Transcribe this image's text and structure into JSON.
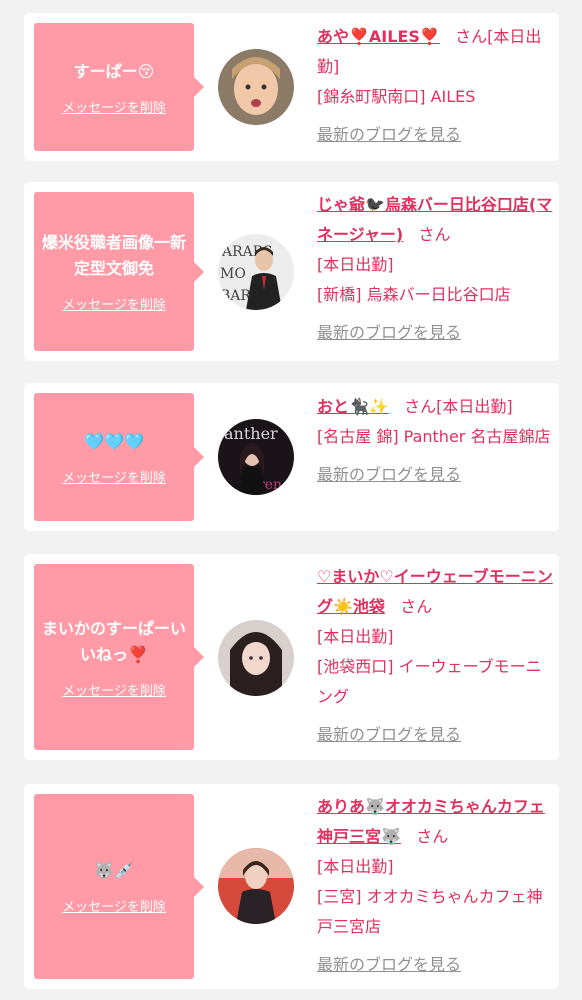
{
  "cards": [
    {
      "message": "すーぱー😚",
      "delete_label": "メッセージを削除",
      "name": "あや❣️AILES❣️",
      "san": "さん",
      "status": "[本日出勤]",
      "location": "[錦糸町駅南口] AILES",
      "blog_link": "最新のブログを見る"
    },
    {
      "message": "爆米役職者画像一新定型文御免",
      "delete_label": "メッセージを削除",
      "name": "じゃ爺🐦‍⬛烏森バー日比谷口店(マネージャー)",
      "san": "さん",
      "status": "[本日出勤]",
      "location": "[新橋] 烏森バー日比谷口店",
      "blog_link": "最新のブログを見る"
    },
    {
      "message": "🩵🩵🩵",
      "delete_label": "メッセージを削除",
      "name": "おと🐈‍⬛✨",
      "san": "さん",
      "status": "[本日出勤]",
      "location": "[名古屋 錦] Panther 名古屋錦店",
      "blog_link": "最新のブログを見る"
    },
    {
      "message": "まいかのすーぱーいいねっ❣️",
      "delete_label": "メッセージを削除",
      "name": "♡まいか♡イーウェーブモーニング☀️池袋",
      "san": "さん",
      "status": "[本日出勤]",
      "location": "[池袋西口] イーウェーブモーニング",
      "blog_link": "最新のブログを見る"
    },
    {
      "message": "🐺💉",
      "delete_label": "メッセージを削除",
      "name": "ありあ🐺オオカミちゃんカフェ神戸三宮🐺",
      "san": "さん",
      "status": "[本日出勤]",
      "location": "[三宮] オオカミちゃんカフェ神戸三宮店",
      "blog_link": "最新のブログを見る"
    }
  ]
}
